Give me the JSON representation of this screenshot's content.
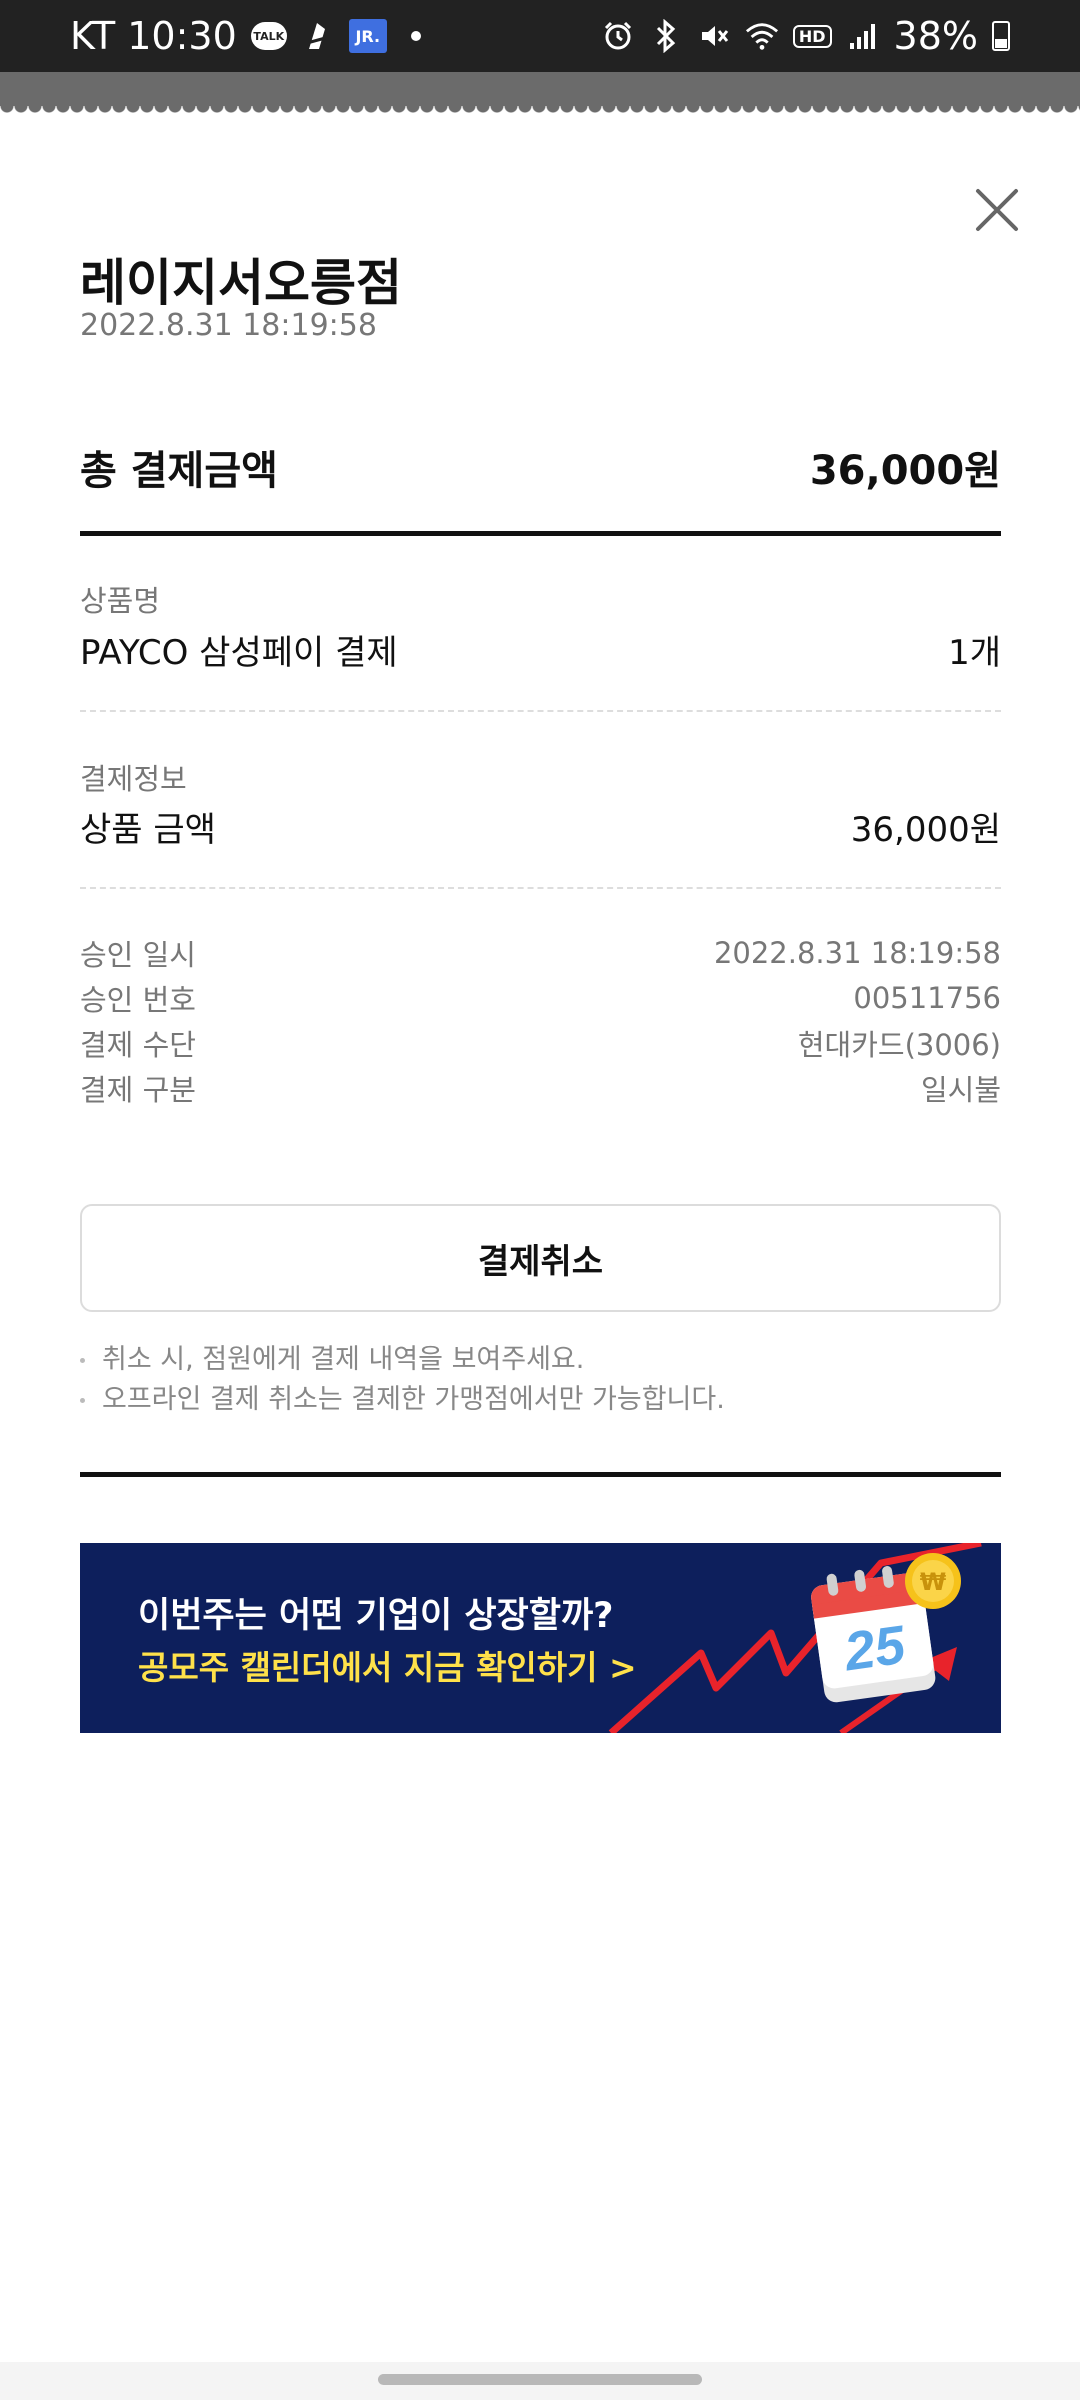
{
  "status_bar": {
    "carrier_time": "KT 10:30",
    "talk_label": "TALK",
    "jr_label": "JR.",
    "hd_label": "HD",
    "battery": "38%"
  },
  "receipt": {
    "store_name": "레이지서오릉점",
    "datetime": "2022.8.31 18:19:58",
    "total_label": "총 결제금액",
    "total_value": "36,000원",
    "product_section_label": "상품명",
    "product_name": "PAYCO 삼성페이 결제",
    "product_qty": "1개",
    "payment_section_label": "결제정보",
    "product_amount_label": "상품 금액",
    "product_amount_value": "36,000원",
    "details": [
      {
        "label": "승인 일시",
        "value": "2022.8.31 18:19:58"
      },
      {
        "label": "승인 번호",
        "value": "00511756"
      },
      {
        "label": "결제 수단",
        "value": "현대카드(3006)"
      },
      {
        "label": "결제 구분",
        "value": "일시불"
      }
    ],
    "cancel_button": "결제취소",
    "notes": [
      "취소 시, 점원에게 결제 내역을 보여주세요.",
      "오프라인 결제 취소는 결제한 가맹점에서만 가능합니다."
    ]
  },
  "banner": {
    "line1": "이번주는 어떤 기업이 상장할까?",
    "line2": "공모주 캘린더에서 지금 확인하기 >",
    "calendar_day": "25",
    "coin_symbol": "₩",
    "background_color": "#0d1f5c",
    "accent_color": "#ffe14a"
  }
}
